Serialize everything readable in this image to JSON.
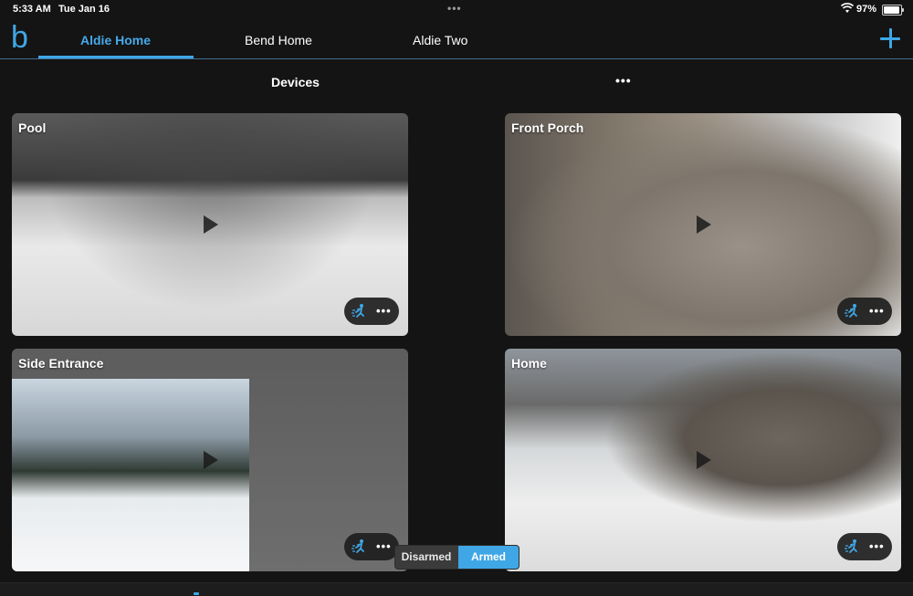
{
  "status_bar": {
    "time": "5:33 AM",
    "date": "Tue Jan 16",
    "dots": "•••",
    "battery_percent": "97%",
    "battery_level": 0.97
  },
  "header": {
    "logo": "b",
    "tabs": [
      {
        "label": "Aldie Home",
        "active": true
      },
      {
        "label": "Bend Home",
        "active": false
      },
      {
        "label": "Aldie Two",
        "active": false
      }
    ],
    "add_icon": "plus-icon"
  },
  "section": {
    "title": "Devices",
    "more": "•••"
  },
  "cameras": [
    {
      "name": "Pool",
      "more": "•••"
    },
    {
      "name": "Front Porch",
      "more": "•••"
    },
    {
      "name": "Side Entrance",
      "more": "•••"
    },
    {
      "name": "Home",
      "more": "•••"
    }
  ],
  "arm_toggle": {
    "disarmed_label": "Disarmed",
    "armed_label": "Armed",
    "selected": "Armed"
  },
  "colors": {
    "accent": "#3fa7e6",
    "background": "#141414"
  }
}
